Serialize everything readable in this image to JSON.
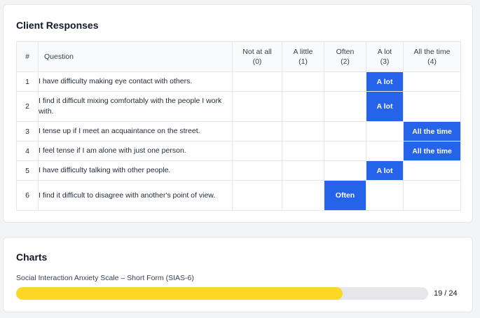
{
  "responses": {
    "title": "Client Responses",
    "columns": {
      "num": "#",
      "question": "Question",
      "options": [
        {
          "label": "Not at all",
          "value": "(0)"
        },
        {
          "label": "A little",
          "value": "(1)"
        },
        {
          "label": "Often",
          "value": "(2)"
        },
        {
          "label": "A lot",
          "value": "(3)"
        },
        {
          "label": "All the time",
          "value": "(4)"
        }
      ]
    },
    "rows": [
      {
        "num": "1",
        "question": "I have difficulty making eye contact with others.",
        "answer": "A lot",
        "selected": 3
      },
      {
        "num": "2",
        "question": "I find it difficult mixing comfortably with the people I work with.",
        "answer": "A lot",
        "selected": 3
      },
      {
        "num": "3",
        "question": "I tense up if I meet an acquaintance on the street.",
        "answer": "All the time",
        "selected": 4
      },
      {
        "num": "4",
        "question": "I feel tense if I am alone with just one person.",
        "answer": "All the time",
        "selected": 4
      },
      {
        "num": "5",
        "question": "I have difficulty talking with other people.",
        "answer": "A lot",
        "selected": 3
      },
      {
        "num": "6",
        "question": "I find it difficult to disagree with another's point of view.",
        "answer": "Often",
        "selected": 2
      }
    ]
  },
  "charts": {
    "title": "Charts",
    "scale_label": "Social Interaction Anxiety Scale – Short Form (SIAS-6)",
    "score": 19,
    "max": 24,
    "score_text": "19 / 24",
    "bar_color": "#fcd728",
    "track_color": "#e5e7eb"
  },
  "colors": {
    "selected_bg": "#2563eb",
    "selected_text": "#ffffff"
  }
}
